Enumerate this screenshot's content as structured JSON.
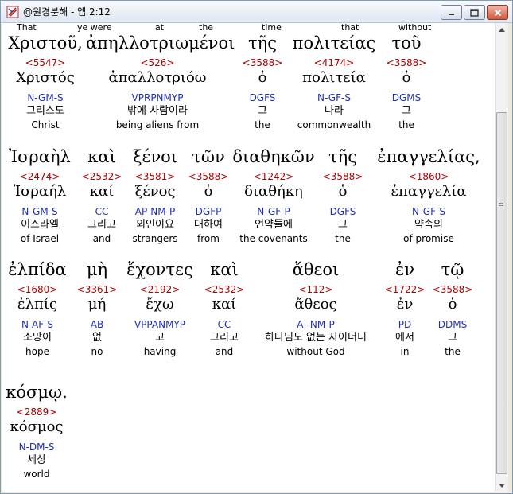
{
  "window": {
    "title": "@원경분해 - 엡 2:12",
    "buttons": {
      "minimize": "minimize",
      "maximize": "maximize",
      "close": "close"
    }
  },
  "top_glosses": [
    "That",
    "ye were",
    "at",
    "the",
    "time",
    "that",
    "without"
  ],
  "rows": [
    [
      {
        "greek": "Χριστοῦ,",
        "strong": "<5547>",
        "lemma": "Χριστός",
        "morph": "N-GM-S",
        "korean": "그리스도",
        "english": "Christ"
      },
      {
        "greek": "ἀπηλλοτριωμένοι",
        "strong": "<526>",
        "lemma": "ἀπαλλοτριόω",
        "morph": "VPRPNMYP",
        "korean": "밖에 사람이라",
        "english": "being aliens from"
      },
      {
        "greek": "τῆς",
        "strong": "<3588>",
        "lemma": "ὁ",
        "morph": "DGFS",
        "korean": "그",
        "english": "the"
      },
      {
        "greek": "πολιτείας",
        "strong": "<4174>",
        "lemma": "πολιτεία",
        "morph": "N-GF-S",
        "korean": "나라",
        "english": "commonwealth"
      },
      {
        "greek": "τοῦ",
        "strong": "<3588>",
        "lemma": "ὁ",
        "morph": "DGMS",
        "korean": "그",
        "english": "the"
      }
    ],
    [
      {
        "greek": "Ἰσραὴλ",
        "strong": "<2474>",
        "lemma": "Ἰσραήλ",
        "morph": "N-GM-S",
        "korean": "이스라엘",
        "english": "of Israel"
      },
      {
        "greek": "καὶ",
        "strong": "<2532>",
        "lemma": "καί",
        "morph": "CC",
        "korean": "그리고",
        "english": "and"
      },
      {
        "greek": "ξένοι",
        "strong": "<3581>",
        "lemma": "ξένος",
        "morph": "AP-NM-P",
        "korean": "외인이요",
        "english": "strangers"
      },
      {
        "greek": "τῶν",
        "strong": "<3588>",
        "lemma": "ὁ",
        "morph": "DGFP",
        "korean": "대하여",
        "english": "from"
      },
      {
        "greek": "διαθηκῶν",
        "strong": "<1242>",
        "lemma": "διαθήκη",
        "morph": "N-GF-P",
        "korean": "언약들에",
        "english": "the covenants"
      },
      {
        "greek": "τῆς",
        "strong": "<3588>",
        "lemma": "ὁ",
        "morph": "DGFS",
        "korean": "그",
        "english": "the"
      },
      {
        "greek": "ἐπαγγελίας,",
        "strong": "<1860>",
        "lemma": "ἐπαγγελία",
        "morph": "N-GF-S",
        "korean": "약속의",
        "english": "of promise"
      }
    ],
    [
      {
        "greek": "ἐλπίδα",
        "strong": "<1680>",
        "lemma": "ἐλπίς",
        "morph": "N-AF-S",
        "korean": "소망이",
        "english": "hope"
      },
      {
        "greek": "μὴ",
        "strong": "<3361>",
        "lemma": "μή",
        "morph": "AB",
        "korean": "없",
        "english": "no"
      },
      {
        "greek": "ἔχοντες",
        "strong": "<2192>",
        "lemma": "ἔχω",
        "morph": "VPPANMYP",
        "korean": "고",
        "english": "having"
      },
      {
        "greek": "καὶ",
        "strong": "<2532>",
        "lemma": "καί",
        "morph": "CC",
        "korean": "그리고",
        "english": "and"
      },
      {
        "greek": "ἄθεοι",
        "strong": "<112>",
        "lemma": "ἄθεος",
        "morph": "A--NM-P",
        "korean": "하나님도 없는 자이더니",
        "english": "without God"
      },
      {
        "greek": "ἐν",
        "strong": "<1722>",
        "lemma": "ἐν",
        "morph": "PD",
        "korean": "에서",
        "english": "in"
      },
      {
        "greek": "τῷ",
        "strong": "<3588>",
        "lemma": "ὁ",
        "morph": "DDMS",
        "korean": "그",
        "english": "the"
      }
    ],
    [
      {
        "greek": "κόσμῳ.",
        "strong": "<2889>",
        "lemma": "κόσμος",
        "morph": "N-DM-S",
        "korean": "세상",
        "english": "world"
      }
    ]
  ]
}
